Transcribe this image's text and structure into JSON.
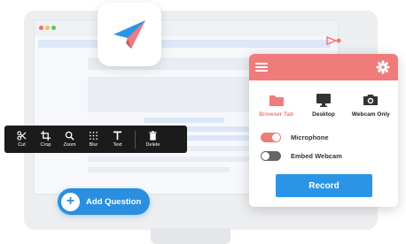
{
  "toolbar": {
    "tools": [
      {
        "label": "Cut",
        "icon": "scissors-icon"
      },
      {
        "label": "Crop",
        "icon": "crop-icon"
      },
      {
        "label": "Zoom",
        "icon": "zoom-icon"
      },
      {
        "label": "Blur",
        "icon": "blur-icon"
      },
      {
        "label": "Text",
        "icon": "text-icon"
      },
      {
        "label": "Delete",
        "icon": "trash-icon"
      }
    ]
  },
  "add_question": {
    "label": "Add Question",
    "icon": "plus-icon"
  },
  "panel": {
    "accent": "#f07b7b",
    "modes": [
      {
        "label": "Browser Tab",
        "icon": "folder-icon",
        "active": true
      },
      {
        "label": "Desktop",
        "icon": "monitor-icon",
        "active": false
      },
      {
        "label": "Webcam Only",
        "icon": "camera-icon",
        "active": false
      }
    ],
    "options": [
      {
        "label": "Microphone",
        "enabled": true
      },
      {
        "label": "Embed Webcam",
        "enabled": false
      }
    ],
    "record_label": "Record"
  },
  "colors": {
    "brand_blue": "#2a8fe0",
    "toolbar_bg": "#1b1b1b",
    "logo_red": "#f07b7b",
    "logo_blue": "#2a95e6"
  }
}
